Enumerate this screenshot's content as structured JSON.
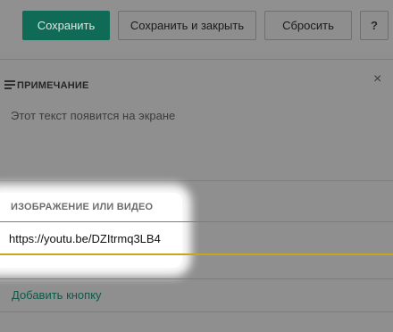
{
  "toolbar": {
    "save_label": "Сохранить",
    "save_close_label": "Сохранить и закрыть",
    "reset_label": "Сбросить",
    "help_label": "?"
  },
  "note": {
    "title": "ПРИМЕЧАНИЕ",
    "close_glyph": "×",
    "placeholder": "Этот текст появится на экране"
  },
  "media": {
    "label": "ИЗОБРАЖЕНИЕ ИЛИ ВИДЕО",
    "url_value": "https://youtu.be/DZItrmq3LB4"
  },
  "add_button_label": "Добавить кнопку",
  "colors": {
    "accent_green": "#0f6b56",
    "focus_underline": "#c7a51c",
    "overlay_gray": "#8f8f8f",
    "link_green": "#0c5a48"
  },
  "icons": {
    "note": "lines-icon",
    "close": "close-icon"
  }
}
